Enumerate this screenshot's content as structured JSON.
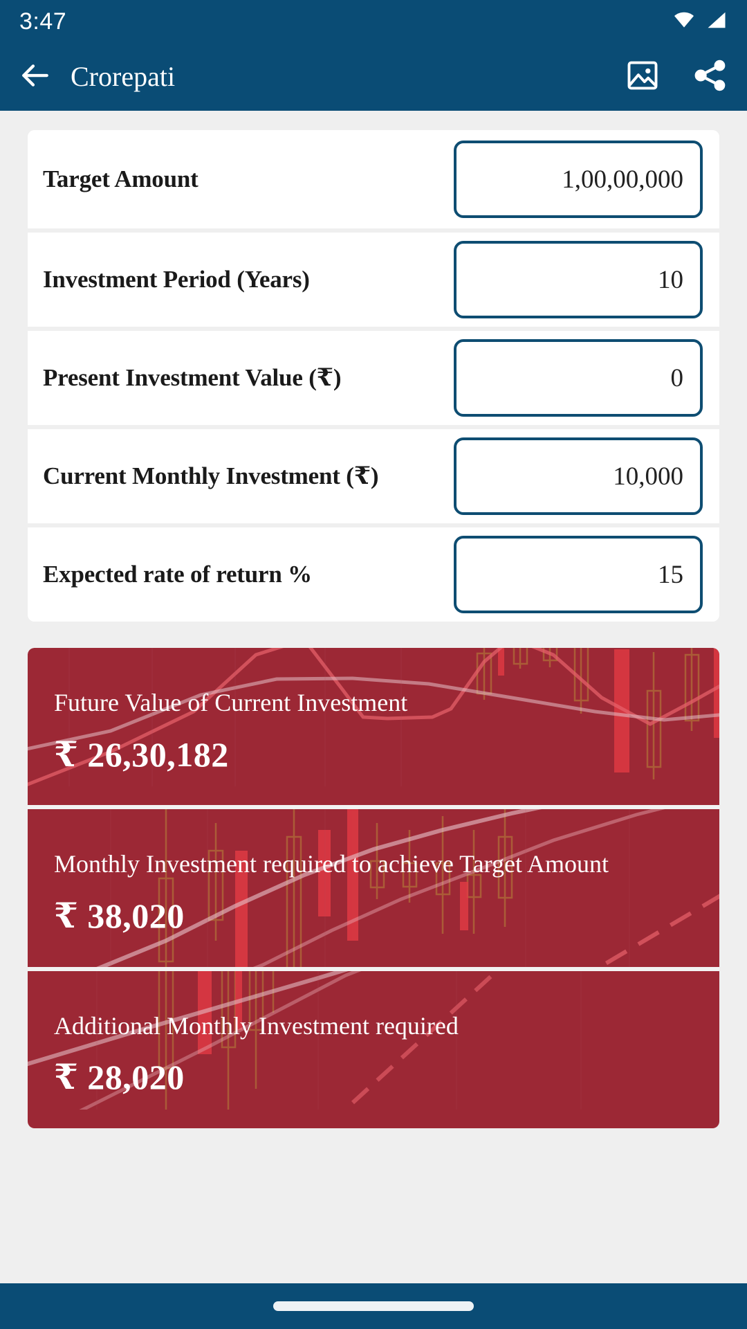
{
  "status_bar": {
    "time": "3:47",
    "icons": [
      "wifi-icon",
      "cellular-signal-icon"
    ]
  },
  "app_bar": {
    "back_icon": "arrow-left-icon",
    "title": "Crorepati",
    "actions": [
      {
        "icon": "image-icon",
        "name": "save-image-button"
      },
      {
        "icon": "share-icon",
        "name": "share-button"
      }
    ]
  },
  "form": {
    "rows": [
      {
        "label": "Target Amount",
        "value": "1,00,00,000",
        "placeholder": "0"
      },
      {
        "label": "Investment Period (Years)",
        "value": "10",
        "placeholder": "0"
      },
      {
        "label": "Present Investment Value (₹)",
        "value": "0",
        "placeholder": "0"
      },
      {
        "label": "Current Monthly Investment (₹)",
        "value": "10,000",
        "placeholder": "0"
      },
      {
        "label": "Expected rate of return %",
        "value": "15",
        "placeholder": "0"
      }
    ]
  },
  "results": {
    "cards": [
      {
        "title": "Future Value of Current Investment",
        "value": "₹ 26,30,182"
      },
      {
        "title": "Monthly Investment required to achieve Target Amount",
        "value": "₹ 38,020"
      },
      {
        "title": "Additional Monthly Investment required",
        "value": "₹ 28,020"
      }
    ]
  },
  "colors": {
    "brand_blue": "#0A4C75",
    "input_border": "#0E4D72",
    "result_red": "#9C2835",
    "page_background": "#EFEFEF",
    "card_white": "#FFFFFF",
    "text_dark": "#1A1A1A",
    "text_light": "#FFFFFF"
  },
  "nav_bar": {
    "gesture_pill": "home-indicator"
  }
}
